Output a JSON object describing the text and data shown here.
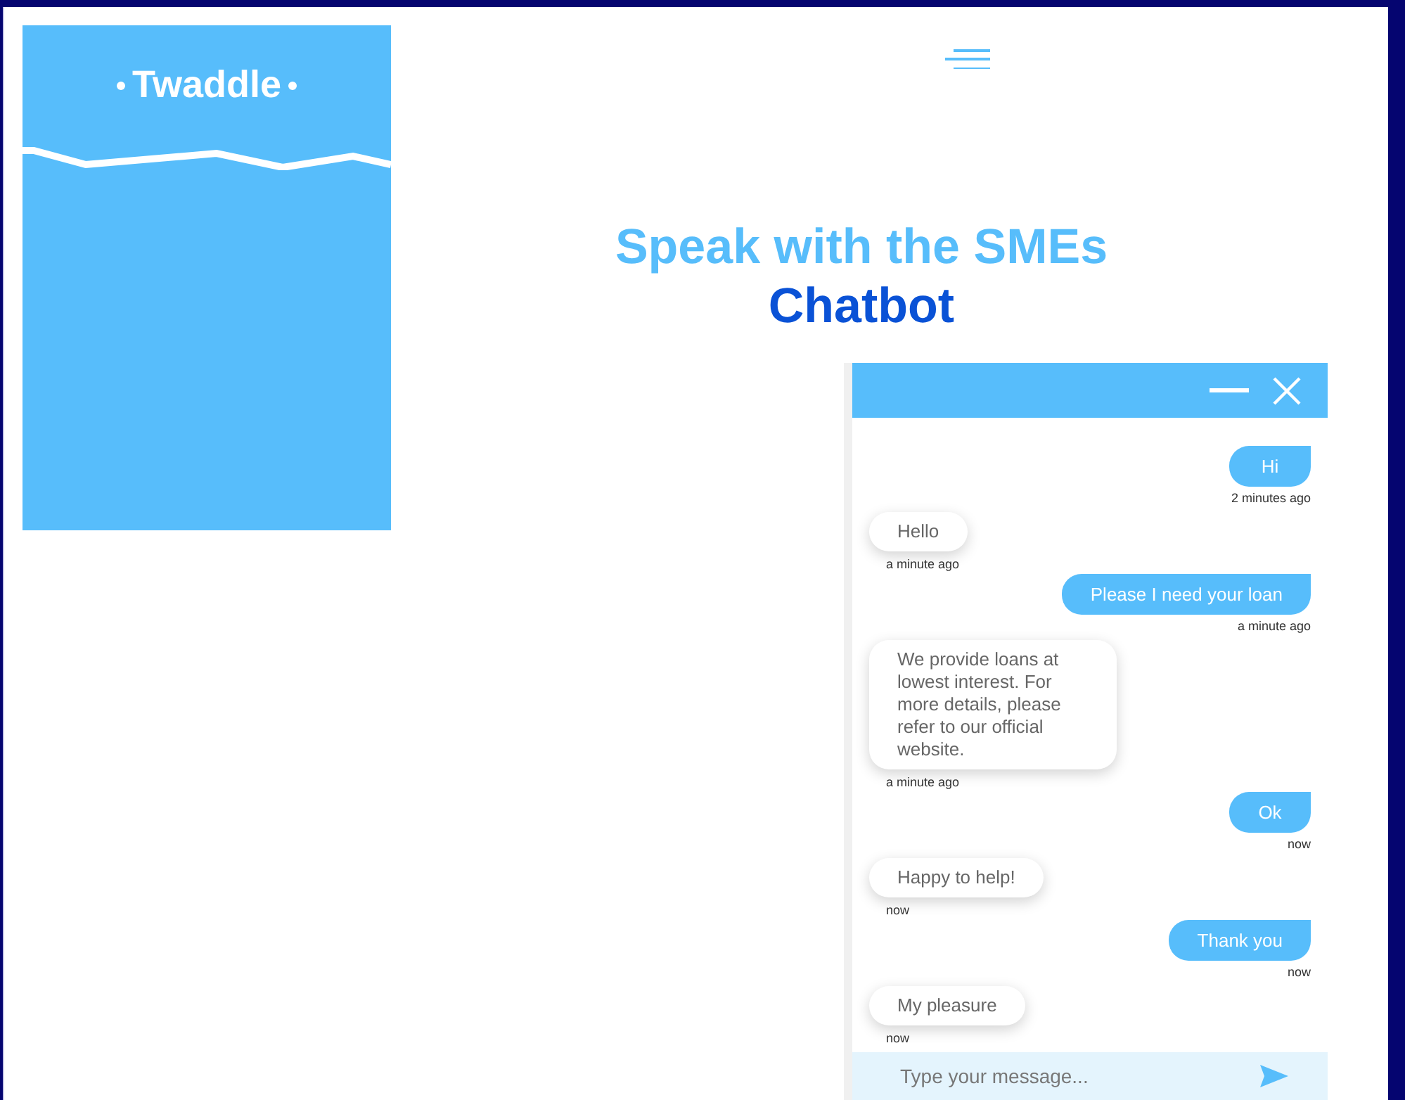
{
  "brand": {
    "name": "Twaddle"
  },
  "heading": {
    "line_1": "Speak with the SMEs",
    "line_2": "Chatbot"
  },
  "chat": {
    "messages": [
      {
        "kind": "user",
        "text": "Hi",
        "time": "2 minutes ago"
      },
      {
        "kind": "bot",
        "text": "Hello",
        "time": "a minute ago"
      },
      {
        "kind": "user",
        "text": "Please I need your loan",
        "time": "a minute ago"
      },
      {
        "kind": "bot",
        "text": "We provide loans at lowest interest. For more details, please refer to our official website.",
        "time": "a minute ago"
      },
      {
        "kind": "user",
        "text": "Ok",
        "time": "now"
      },
      {
        "kind": "bot",
        "text": "Happy to help!",
        "time": "now"
      },
      {
        "kind": "user",
        "text": "Thank you",
        "time": "now"
      },
      {
        "kind": "bot",
        "text": "My pleasure",
        "time": "now"
      }
    ],
    "input": {
      "placeholder": "Type your message..."
    }
  }
}
